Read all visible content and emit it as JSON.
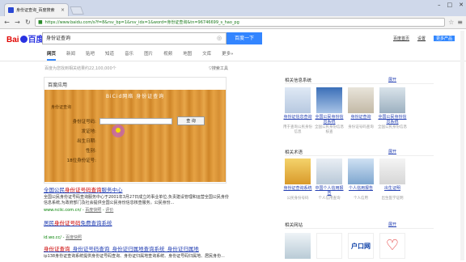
{
  "browser": {
    "tab_title": "身份证查询_百度搜索",
    "url": "https://www.baidu.com/s?f=8&rsv_bp=1&rsv_idx=1&word=身份证查询&tn=96746699_s_hao_pg",
    "window_controls": [
      "–",
      "□",
      "✕"
    ]
  },
  "baidu": {
    "logo_left": "Bai",
    "logo_right": "百度",
    "query": "身份证查询",
    "search_button": "百度一下",
    "top_links": [
      "百度首页",
      "设置",
      "更多产品"
    ],
    "tabs": [
      "网页",
      "新闻",
      "贴吧",
      "知道",
      "音乐",
      "图片",
      "视频",
      "地图",
      "文库",
      "更多»"
    ],
    "result_count": "百度为您找到相关结果约22,100,000个",
    "search_tools": "搜索工具"
  },
  "card": {
    "title": "百度应用",
    "banner": "BiCid网络  身份证查询",
    "sub": "身份证查询",
    "fields": [
      "身份证号码:",
      "发证地:",
      "出生日期:",
      "性别:",
      "18位身份证号:"
    ],
    "query_button": "查 询"
  },
  "results": [
    {
      "title_pre": "全国公民",
      "title_hl": "身份证号码查询",
      "title_post": "服务中心",
      "desc": "全国公民身份证号码查询服务中心于2001年3月27日成立的事业单位,负责建设管理和运营全国公民身份信息系统,为政府部门及社会提供全国公民身份信息核查服务。公民身份...",
      "url": "www.nciic.com.cn/",
      "snap": "百度快照",
      "extra": "评价"
    },
    {
      "title_pre": "居民",
      "title_hl": "身份证号码",
      "title_post": "免费查询系统",
      "desc": "",
      "url": "id.wo.cc/",
      "snap": "百度快照",
      "extra": ""
    },
    {
      "title_pre": "身份证查询",
      "title_hl": "",
      "title_post": "_身份证号码查询_身份证归属地查询系统_身份证归属地",
      "desc": "ip138身份证查询系统提供身份证号码查询、身份证归属地查询系统、身份证号码归属地、居民身份...",
      "url": "",
      "snap": "",
      "extra": ""
    }
  ],
  "right": {
    "section1": "相关信息系统",
    "section2": "相关术语",
    "section3": "相关网站",
    "fold": "展开",
    "row1": [
      {
        "cap": "身份证信息查询",
        "sub": "用于查询公民身份信息"
      },
      {
        "cap": "全国公民身份信息系统",
        "sub": "全国公民身份信息核查"
      },
      {
        "cap": "身份证查询",
        "sub": "身份证号码查询"
      },
      {
        "cap": "全国公民身份信息系统",
        "sub": "全国公民身份信息"
      }
    ],
    "row2": [
      {
        "cap": "身份证查询系统",
        "sub": "公民身份号码"
      },
      {
        "cap": "中国个人信用报告",
        "sub": "个人信用查询"
      },
      {
        "cap": "个人信用报告",
        "sub": "个人信用"
      },
      {
        "cap": "出生证明",
        "sub": "出生医学证明"
      }
    ],
    "row3": [
      {
        "cap": "",
        "sub": ""
      },
      {
        "cap": "户口网",
        "sub": ""
      },
      {
        "cap": "",
        "sub": ""
      },
      {
        "cap": "",
        "sub": ""
      }
    ]
  },
  "colors": {
    "accent": "#3385ff",
    "link": "#2440b3",
    "highlight": "#cc0000",
    "url": "#008000"
  }
}
